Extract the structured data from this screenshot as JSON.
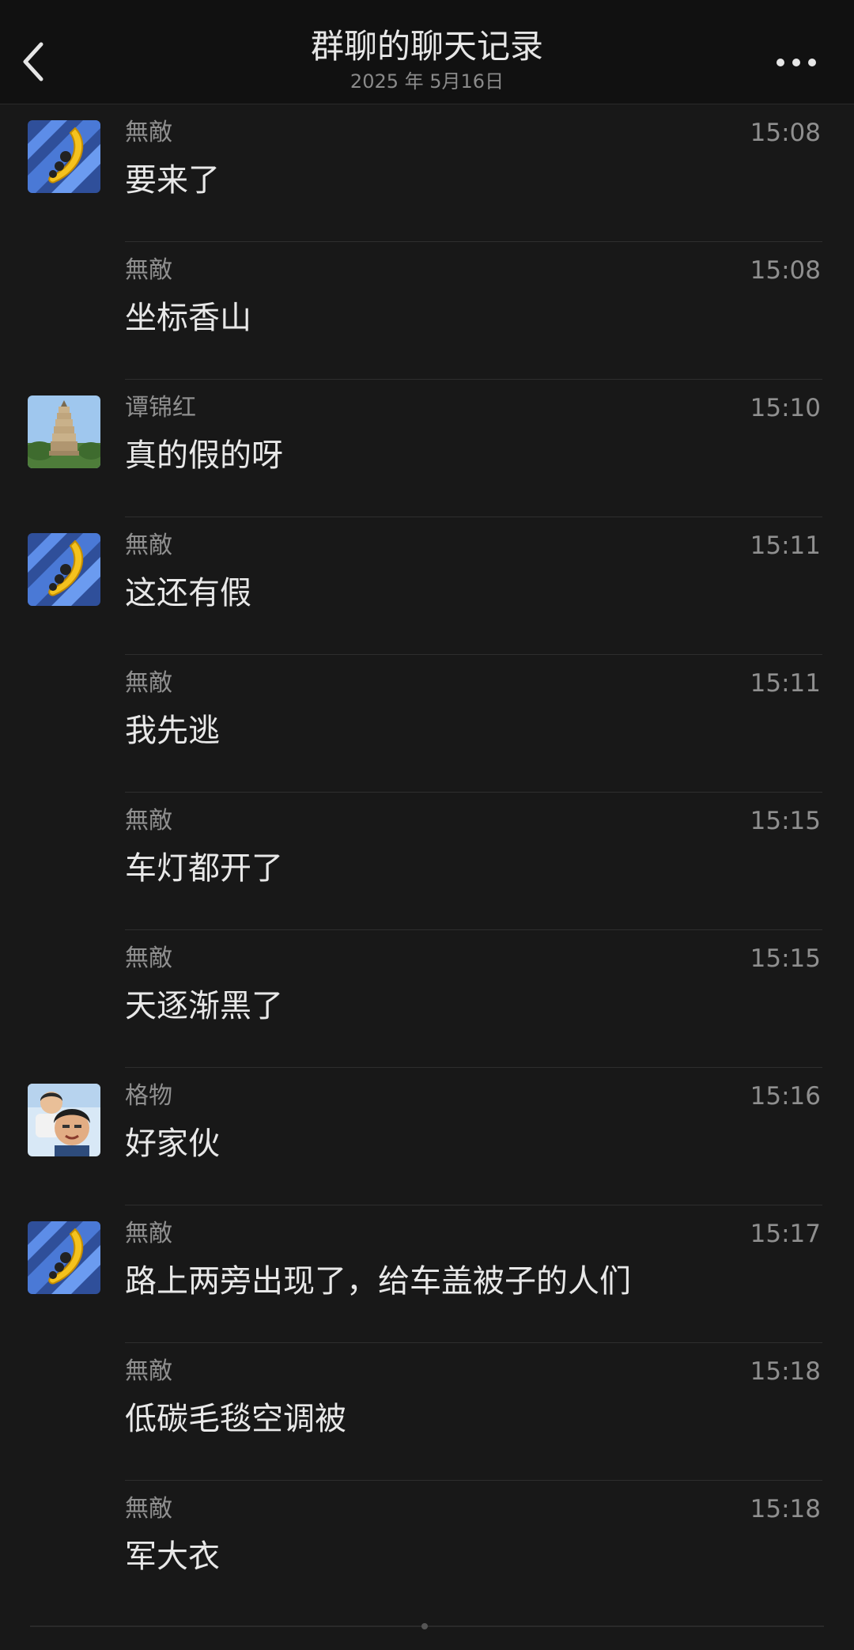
{
  "header": {
    "title": "群聊的聊天记录",
    "subtitle": "2025 年 5月16日",
    "back_icon": "chevron-left-icon",
    "more_icon": "more-horizontal-icon"
  },
  "colors": {
    "background": "#181818",
    "header_bg": "#111111",
    "primary_text": "#e8e8e8",
    "secondary_text": "#8f8f8f",
    "divider": "#2e2e2e"
  },
  "avatars": {
    "wudi": "banana-avatar",
    "tanjinhong": "pagoda-avatar",
    "gewu": "person-photo-avatar"
  },
  "messages": [
    {
      "sender": "無敵",
      "time": "15:08",
      "text": "要来了"
    },
    {
      "sender": "無敵",
      "time": "15:08",
      "text": "坐标香山"
    },
    {
      "sender": "谭锦红",
      "time": "15:10",
      "text": "真的假的呀"
    },
    {
      "sender": "無敵",
      "time": "15:11",
      "text": "这还有假"
    },
    {
      "sender": "無敵",
      "time": "15:11",
      "text": "我先逃"
    },
    {
      "sender": "無敵",
      "time": "15:15",
      "text": "车灯都开了"
    },
    {
      "sender": "無敵",
      "time": "15:15",
      "text": "天逐渐黑了"
    },
    {
      "sender": "格物",
      "time": "15:16",
      "text": "好家伙"
    },
    {
      "sender": "無敵",
      "time": "15:17",
      "text": "路上两旁出现了，给车盖被子的人们"
    },
    {
      "sender": "無敵",
      "time": "15:18",
      "text": "低碳毛毯空调被"
    },
    {
      "sender": "無敵",
      "time": "15:18",
      "text": "军大衣"
    }
  ]
}
